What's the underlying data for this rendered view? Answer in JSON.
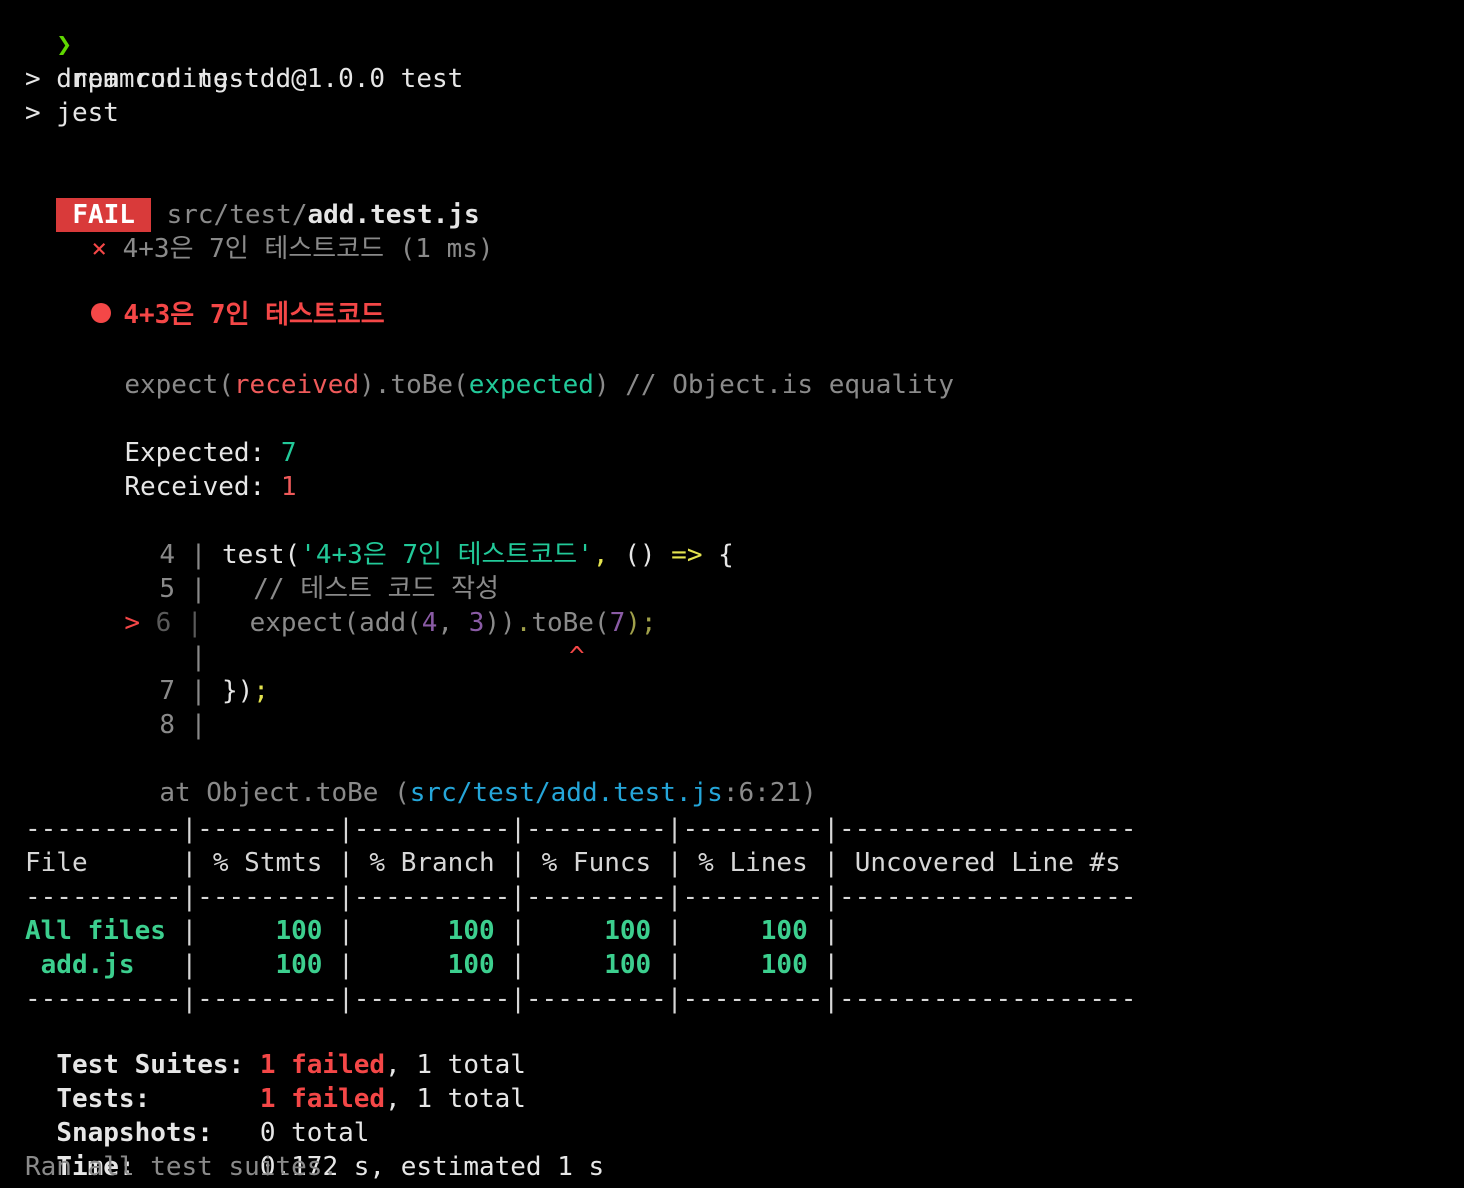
{
  "prompt": {
    "symbol": "❯",
    "command": "npm run test"
  },
  "script_lines": [
    "> dreamcoding-tdd@1.0.0 test",
    "> jest"
  ],
  "fail_header": {
    "badge": "FAIL",
    "path_prefix": "src/test/",
    "filename": "add.test.js"
  },
  "test_result": {
    "mark": "×",
    "name": "4+3은 7인 테스트코드",
    "duration": "(1 ms)"
  },
  "failure": {
    "title": "4+3은 7인 테스트코드",
    "matcher": {
      "expect": "expect(",
      "received": "received",
      "mid": ").toBe(",
      "expected": "expected",
      "close": ")",
      "comment": " // Object.is equality"
    },
    "expected_label": "Expected:",
    "expected_value": "7",
    "received_label": "Received:",
    "received_value": "1"
  },
  "code_frame": {
    "lines": [
      {
        "num": "4",
        "text_prefix": "test(",
        "text_string": "'4+3은 7인 테스트코드'",
        "text_comma": ",",
        "text_rest": " () ",
        "text_arrow": "=>",
        "text_brace": " {"
      },
      {
        "num": "5",
        "comment": "// 테스트 코드 작성"
      },
      {
        "num": "6",
        "marker": ">",
        "code_a": "expect(add(",
        "arg1": "4",
        "comma1": ", ",
        "arg2": "3",
        "code_b": "))",
        "dot": ".",
        "code_c": "toBe(",
        "arg3": "7",
        "code_d": ");"
      },
      {
        "num": "",
        "caret": "^"
      },
      {
        "num": "7",
        "close": "})",
        "semi": ";"
      },
      {
        "num": "8"
      }
    ],
    "stack": {
      "prefix": "at Object.toBe (",
      "location": "src/test/add.test.js",
      "position": ":6:21)"
    }
  },
  "coverage": {
    "dashes": "----------|---------|----------|---------|---------|-------------------",
    "headers": [
      "File",
      "% Stmts",
      "% Branch",
      "% Funcs",
      "% Lines",
      "Uncovered Line #s"
    ],
    "rows": [
      {
        "file": "All files",
        "stmts": "100",
        "branch": "100",
        "funcs": "100",
        "lines": "100",
        "uncovered": ""
      },
      {
        "file": " add.js",
        "stmts": "100",
        "branch": "100",
        "funcs": "100",
        "lines": "100",
        "uncovered": ""
      }
    ]
  },
  "summary": {
    "suites_label": "Test Suites:",
    "suites_failed": "1 failed",
    "suites_total": ", 1 total",
    "tests_label": "Tests:",
    "tests_failed": "1 failed",
    "tests_total": ", 1 total",
    "snapshots_label": "Snapshots:",
    "snapshots_value": "0 total",
    "time_label": "Time:",
    "time_value": "0.172 s, estimated 1 s",
    "ran_all": "Ran all test suites."
  },
  "colors": {
    "background": "#000000",
    "fail_badge": "#d93a3a",
    "error_red": "#f44747",
    "success_green": "#3ccf8e",
    "link_cyan": "#25a6d9"
  }
}
